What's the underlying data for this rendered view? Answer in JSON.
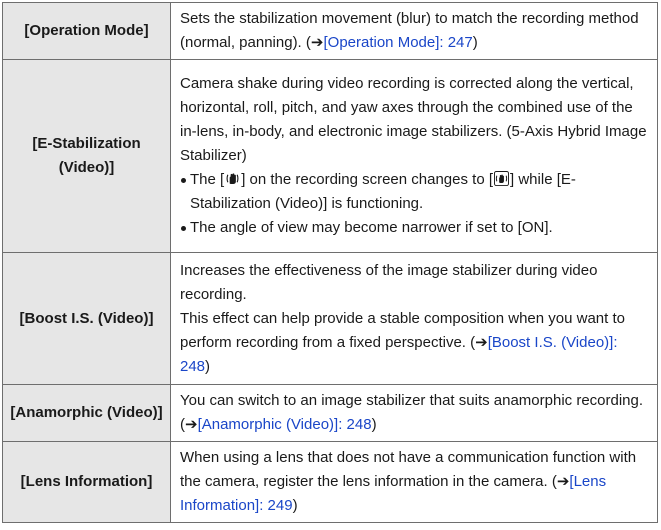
{
  "rows": [
    {
      "term": "[Operation Mode]",
      "desc": "Sets the stabilization movement (blur) to match the recording method (normal, panning). (",
      "link": "[Operation Mode]: 247",
      "desc_end": ")"
    },
    {
      "term": "[E-Stabilization (Video)]",
      "desc": "Camera shake during video recording is corrected along the vertical, horizontal, roll, pitch, and yaw axes through the combined use of the in-lens, in-body, and electronic image stabilizers. (5-Axis Hybrid Image Stabilizer)",
      "bullet1_a": "The [",
      "bullet1_b": "] on the recording screen changes to [",
      "bullet1_c": "] while [E-Stabilization (Video)] is functioning.",
      "bullet2": "The angle of view may become narrower if set to [ON]."
    },
    {
      "term": "[Boost I.S. (Video)]",
      "desc1": "Increases the effectiveness of the image stabilizer during video recording.",
      "desc2": "This effect can help provide a stable composition when you want to perform recording from a fixed perspective. (",
      "link": "[Boost I.S. (Video)]: 248",
      "desc_end": ")"
    },
    {
      "term": "[Anamorphic (Video)]",
      "desc": "You can switch to an image stabilizer that suits anamorphic recording. (",
      "link": "[Anamorphic (Video)]: 248",
      "desc_end": ")"
    },
    {
      "term": "[Lens Information]",
      "desc": "When using a lens that does not have a communication function with the camera, register the lens information in the camera. (",
      "link": "[Lens Information]: 249",
      "desc_end": ")"
    }
  ],
  "arrow_glyph": "➔",
  "icons": {
    "stabilizer": "hand-shake-stabilizer-icon",
    "e_stabilizer": "hybrid-stabilizer-icon"
  },
  "colors": {
    "link": "#1a46c8",
    "term_bg": "#e6e6e6",
    "border": "#6e6e6e"
  }
}
